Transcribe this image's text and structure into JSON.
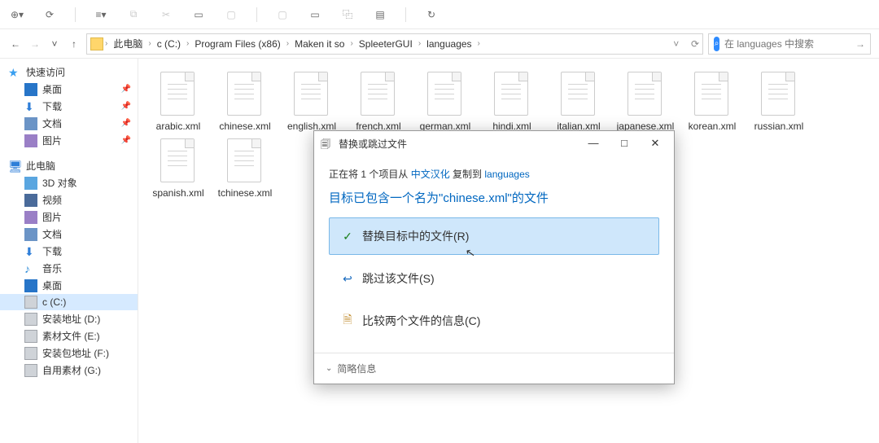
{
  "breadcrumb": [
    "此电脑",
    "c (C:)",
    "Program Files (x86)",
    "Maken it so",
    "SpleeterGUI",
    "languages"
  ],
  "search": {
    "placeholder": "在 languages 中搜索"
  },
  "sidebar": {
    "quick": {
      "title": "快速访问",
      "items": [
        "桌面",
        "下载",
        "文档",
        "图片"
      ]
    },
    "pc": {
      "title": "此电脑",
      "items": [
        "3D 对象",
        "视频",
        "图片",
        "文档",
        "下载",
        "音乐",
        "桌面",
        "c (C:)",
        "安装地址 (D:)",
        "素材文件 (E:)",
        "安装包地址 (F:)",
        "自用素材 (G:)"
      ]
    }
  },
  "files": [
    "arabic.xml",
    "chinese.xml",
    "english.xml",
    "french.xml",
    "german.xml",
    "hindi.xml",
    "italian.xml",
    "japanese.xml",
    "korean.xml",
    "russian.xml",
    "spanish.xml",
    "tchinese.xml"
  ],
  "dialog": {
    "title": "替换或跳过文件",
    "msg_pre": "正在将 1 个项目从 ",
    "msg_link1": "中文汉化",
    "msg_mid": " 复制到 ",
    "msg_link2": "languages",
    "heading": "目标已包含一个名为\"chinese.xml\"的文件",
    "opt1": "替换目标中的文件(R)",
    "opt2": "跳过该文件(S)",
    "opt3": "比较两个文件的信息(C)",
    "foot": "简略信息"
  }
}
